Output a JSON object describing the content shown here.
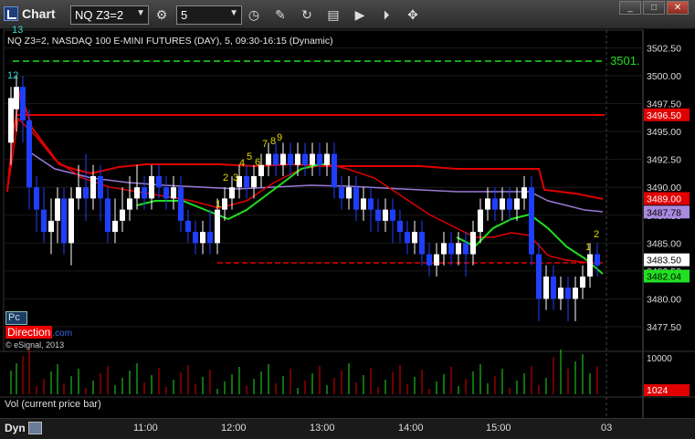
{
  "app": {
    "title": "Chart"
  },
  "toolbar": {
    "symbol": "NQ Z3=2",
    "interval": "5",
    "icons": [
      "settings-icon",
      "clock-icon",
      "pencil-icon",
      "refresh-icon",
      "studies-icon",
      "play-icon",
      "play-circle-icon",
      "pin-icon"
    ]
  },
  "window_buttons": {
    "minimize": "_",
    "maximize": "□",
    "close": "✕"
  },
  "chart": {
    "info": "NQ Z3=2, NASDAQ 100 E-MINI FUTURES (DAY), 5, 09:30-16:15 (Dynamic)",
    "price_ticks": [
      "3502.50",
      "3500.00",
      "3497.50",
      "3495.00",
      "3492.50",
      "3490.00",
      "3487.50",
      "3485.00",
      "3482.50",
      "3480.00",
      "3477.50"
    ],
    "labels": {
      "green_level": "3501.",
      "red_level": "3496.50",
      "red_ma": "3489.00",
      "purple_ma": "3487.78",
      "last_price": "3483.50",
      "green_ma": "3482.04",
      "bottom_hidden": "3483.50"
    },
    "count_labels": {
      "top_left_cyan": "13",
      "top_left_12": "12",
      "seq": [
        "1",
        "2",
        "3",
        "4",
        "5",
        "6",
        "7",
        "8",
        "9",
        "1",
        "2"
      ]
    },
    "logo": {
      "pc": "Pc",
      "direction": "Direction",
      "suffix": ".com",
      "copyright": "© eSignal, 2013"
    },
    "colors": {
      "up": "#ffffff",
      "down": "#1f3fff",
      "red": "#e00000",
      "green": "#1ee01e",
      "purple": "#9a7ad8",
      "count": "#e8d800"
    }
  },
  "volume": {
    "label": "Vol (current price bar)",
    "ticks": [
      "10000",
      "1024"
    ],
    "last": "1024"
  },
  "bottom": {
    "mode": "Dyn",
    "times": [
      "11:00",
      "12:00",
      "13:00",
      "14:00",
      "15:00",
      "03"
    ]
  }
}
